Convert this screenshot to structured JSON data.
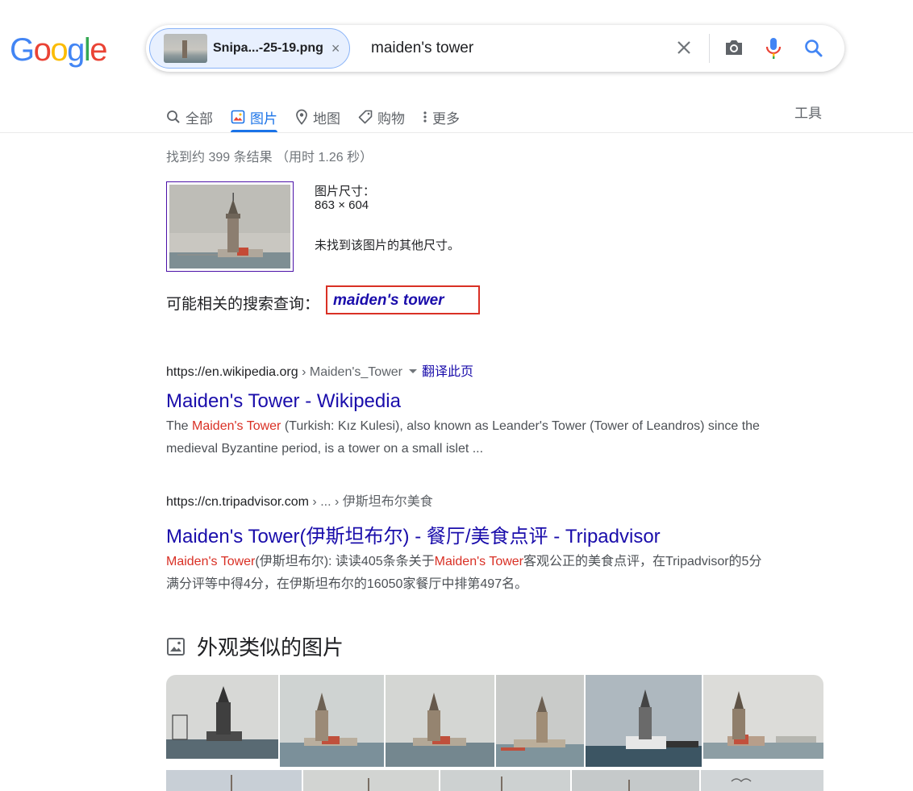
{
  "logo": {
    "text": "Google"
  },
  "search": {
    "chip_filename": "Snipa...-25-19.png",
    "chip_close": "×",
    "query": "maiden's tower"
  },
  "tabs": [
    {
      "label": "全部",
      "icon": "search-icon"
    },
    {
      "label": "图片",
      "icon": "image-icon",
      "active": true
    },
    {
      "label": "地图",
      "icon": "map-pin-icon"
    },
    {
      "label": "购物",
      "icon": "tag-icon"
    },
    {
      "label": "更多",
      "icon": "more-vert-icon"
    }
  ],
  "tools_label": "工具",
  "stats": "找到约 399 条结果 （用时 1.26 秒）",
  "image_info": {
    "size_label": "图片尺寸：",
    "size_value": "863 × 604",
    "no_other_sizes": "未找到该图片的其他尺寸。"
  },
  "related": {
    "label": "可能相关的搜索查询：",
    "query": "maiden's tower"
  },
  "results": [
    {
      "url": "https://en.wikipedia.org",
      "crumb": " › Maiden's_Tower",
      "translate": "翻译此页",
      "title": "Maiden's Tower - Wikipedia",
      "snippet_pre": "The ",
      "snippet_hl": "Maiden's Tower",
      "snippet_post": " (Turkish: Kız Kulesi), also known as Leander's Tower (Tower of Leandros) since the medieval Byzantine period, is a tower on a small islet ..."
    },
    {
      "url": "https://cn.tripadvisor.com",
      "crumb": " › ... › 伊斯坦布尔美食",
      "title": "Maiden's Tower(伊斯坦布尔) - 餐厅/美食点评 - Tripadvisor",
      "snippet_hl1": "Maiden's Tower",
      "snippet_mid1": "(伊斯坦布尔): 读读405条条关于",
      "snippet_hl2": "Maiden's Tower",
      "snippet_post": "客观公正的美食点评，在Tripadvisor的5分满分评等中得4分，在伊斯坦布尔的16050家餐厅中排第497名。"
    }
  ],
  "similar": {
    "title": "外观类似的图片"
  },
  "colors": {
    "link": "#1a0dab",
    "accent": "#1a73e8",
    "highlight": "#d93025"
  }
}
